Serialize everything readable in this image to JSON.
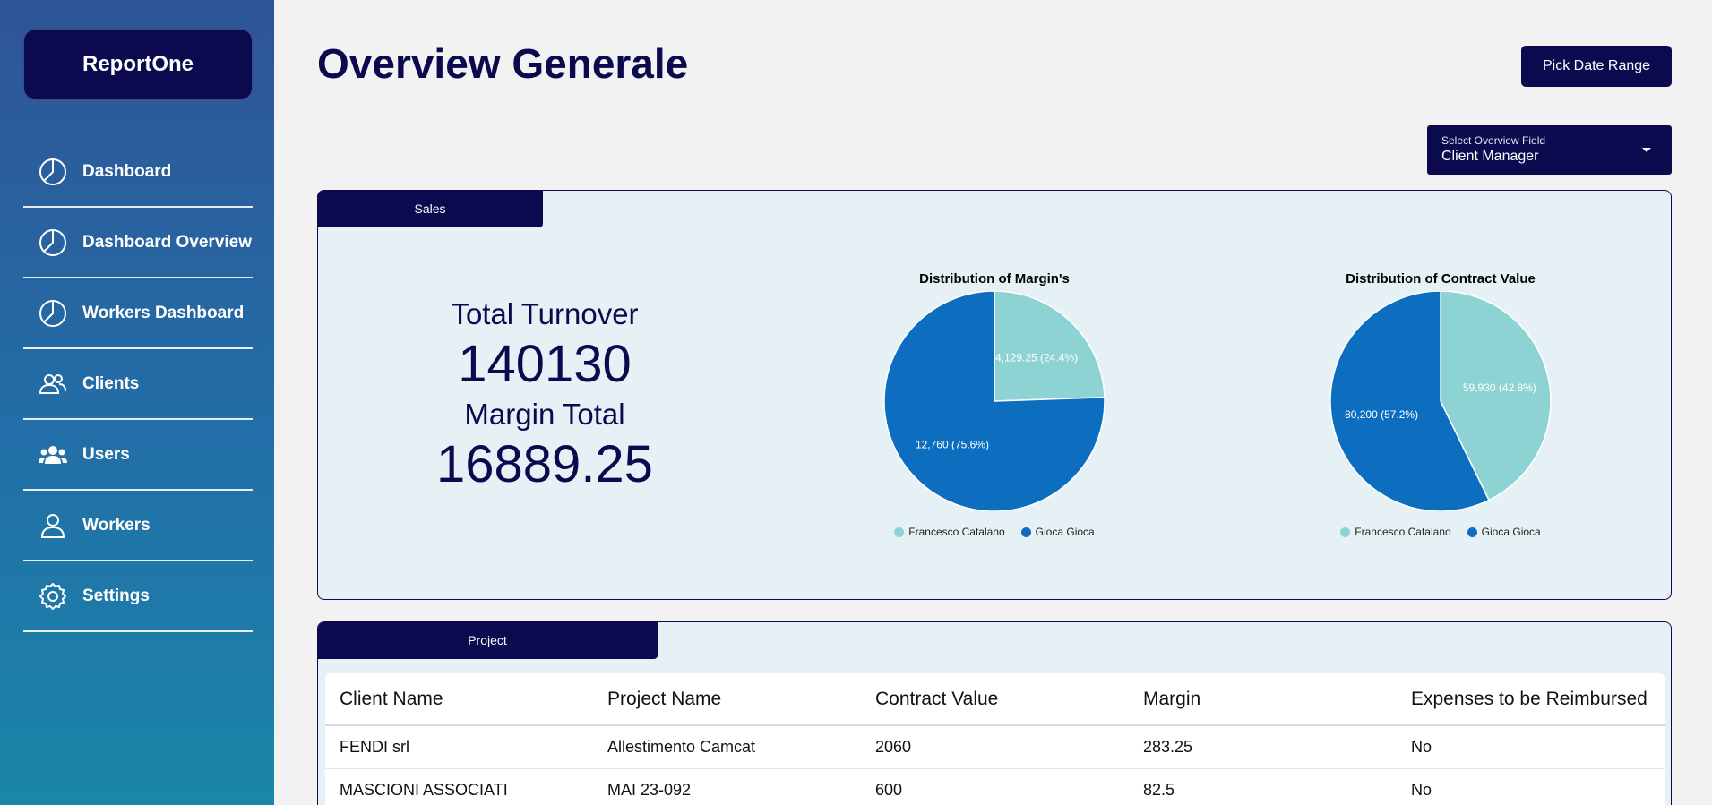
{
  "app": {
    "name": "ReportOne"
  },
  "sidebar": {
    "items": [
      {
        "label": "Dashboard",
        "icon": "pie-chart-icon"
      },
      {
        "label": "Dashboard Overview",
        "icon": "pie-chart-icon"
      },
      {
        "label": "Workers Dashboard",
        "icon": "pie-chart-icon"
      },
      {
        "label": "Clients",
        "icon": "users-icon"
      },
      {
        "label": "Users",
        "icon": "group-icon"
      },
      {
        "label": "Workers",
        "icon": "user-icon"
      },
      {
        "label": "Settings",
        "icon": "gear-icon"
      }
    ]
  },
  "header": {
    "title": "Overview Generale",
    "date_button": "Pick Date Range",
    "select": {
      "label": "Select Overview Field",
      "value": "Client Manager"
    }
  },
  "sales": {
    "tab": "Sales",
    "turnover_label": "Total Turnover",
    "turnover_value": "140130",
    "margin_label": "Margin Total",
    "margin_value": "16889.25"
  },
  "colors": {
    "light": "#8dd3d3",
    "dark": "#0d6ebf",
    "navy": "#0c0a4e"
  },
  "chart_data": [
    {
      "type": "pie",
      "title": "Distribution of Margin's",
      "categories": [
        "Francesco Catalano",
        "Gioca Gioca"
      ],
      "values": [
        4129.25,
        12760
      ],
      "labels": [
        "4,129.25 (24.4%)",
        "12,760 (75.6%)"
      ],
      "legend": "bottom"
    },
    {
      "type": "pie",
      "title": "Distribution of Contract Value",
      "categories": [
        "Francesco Catalano",
        "Gioca Gioca"
      ],
      "values": [
        59930,
        80200
      ],
      "labels": [
        "59,930 (42.8%)",
        "80,200 (57.2%)"
      ],
      "legend": "bottom"
    }
  ],
  "project": {
    "tab": "Project",
    "columns": [
      "Client Name",
      "Project Name",
      "Contract Value",
      "Margin",
      "Expenses to be Reimbursed"
    ],
    "rows": [
      [
        "FENDI srl",
        "Allestimento Camcat",
        "2060",
        "283.25",
        "No"
      ],
      [
        "MASCIONI ASSOCIATI",
        "MAI 23-092",
        "600",
        "82.5",
        "No"
      ]
    ]
  }
}
